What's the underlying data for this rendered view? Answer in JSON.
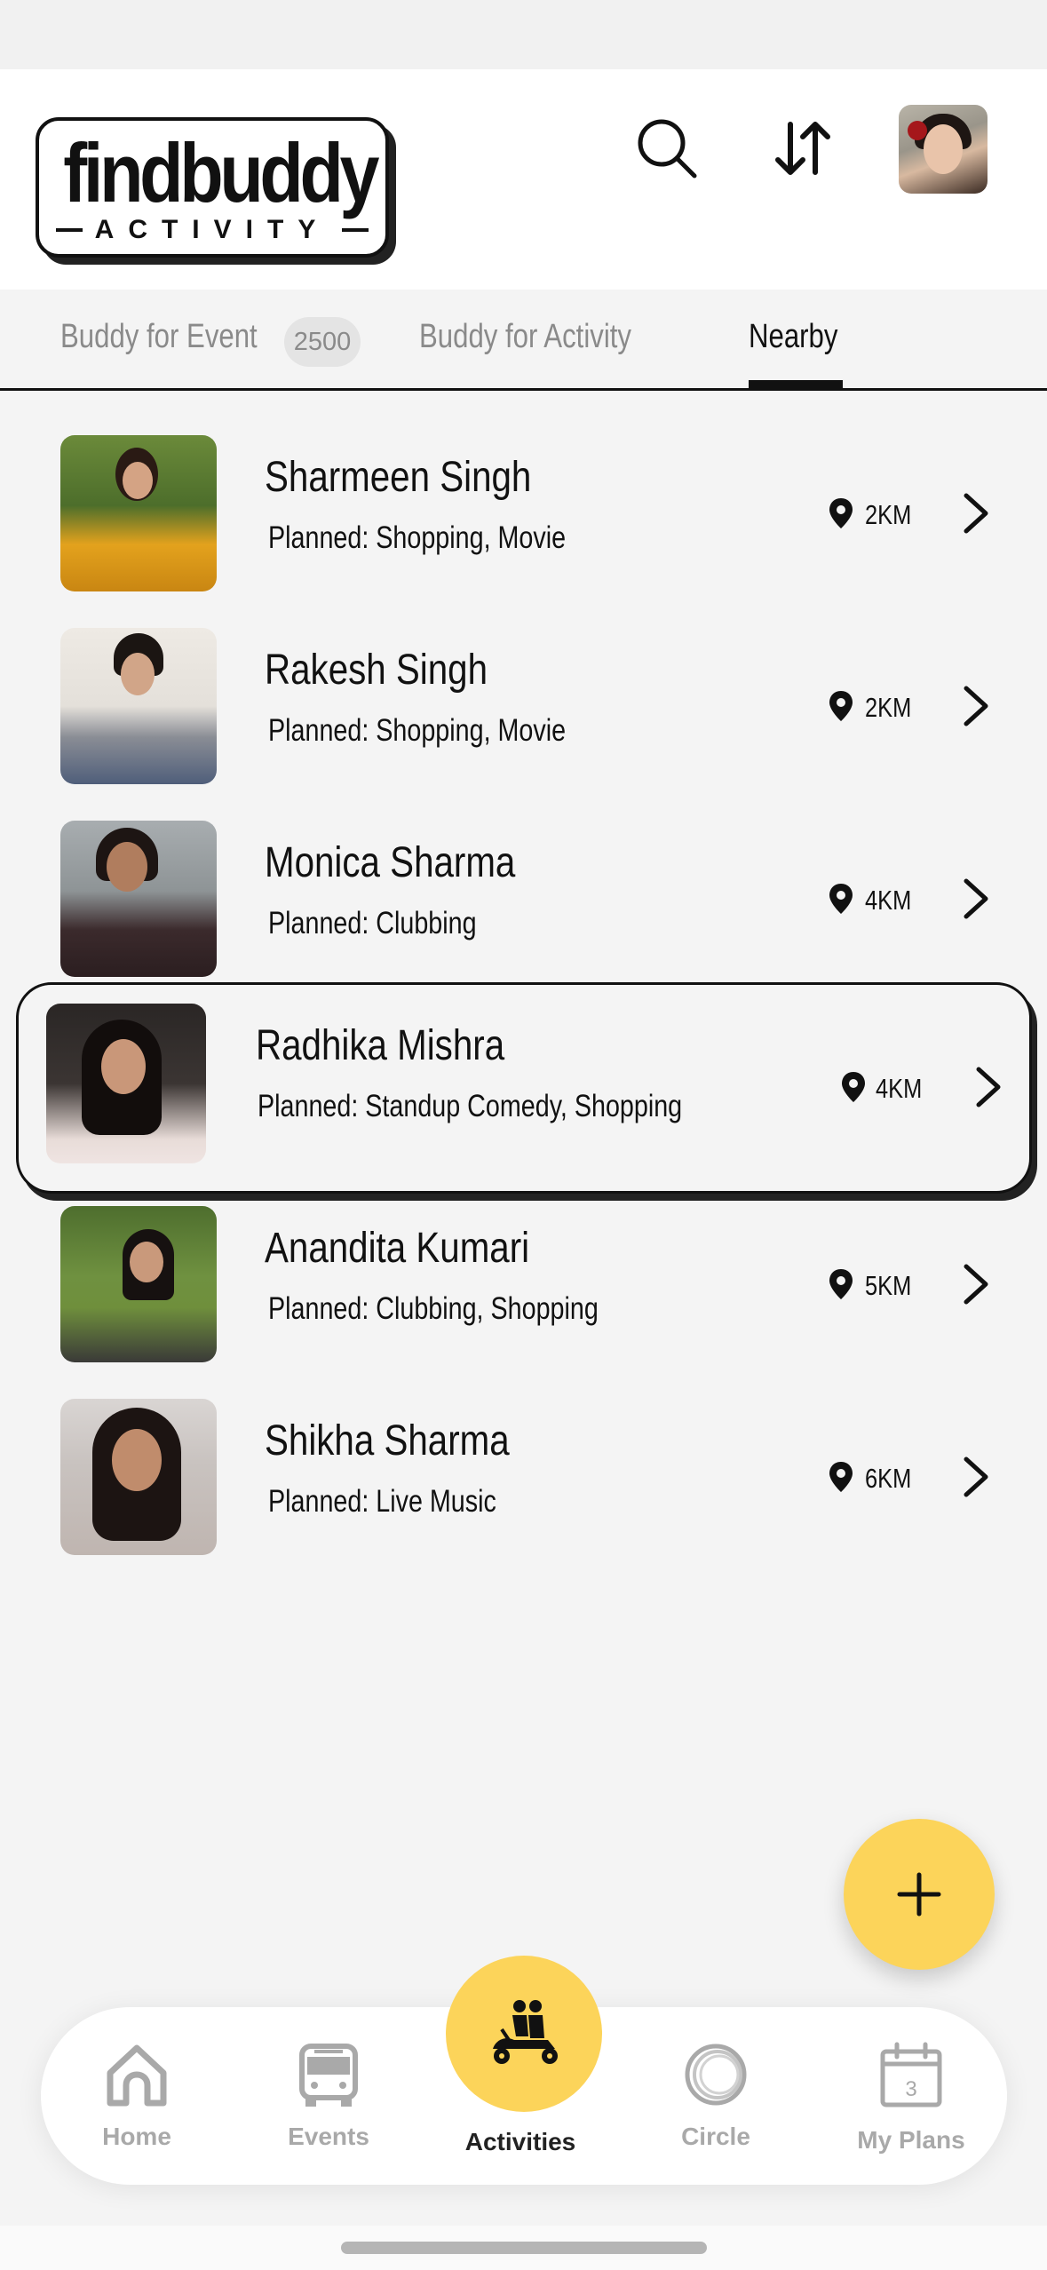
{
  "app": {
    "logo_main": "findbuddy",
    "logo_sub": "ACTIVITY"
  },
  "header": {
    "search_icon": "search-icon",
    "sort_icon": "sort-arrows-icon",
    "avatar": "user-avatar"
  },
  "tabs": [
    {
      "label": "Buddy for Event",
      "badge": "2500",
      "active": false
    },
    {
      "label": "Buddy for Activity",
      "active": false
    },
    {
      "label": "Nearby",
      "active": true
    }
  ],
  "buddies": [
    {
      "name": "Sharmeen Singh",
      "planned": "Planned: Shopping, Movie",
      "distance": "2KM"
    },
    {
      "name": "Rakesh Singh",
      "planned": "Planned: Shopping, Movie",
      "distance": "2KM"
    },
    {
      "name": "Monica Sharma",
      "planned": "Planned: Clubbing",
      "distance": "4KM"
    },
    {
      "name": "Radhika Mishra",
      "planned": "Planned: Standup Comedy, Shopping",
      "distance": "4KM",
      "highlighted": true
    },
    {
      "name": "Anandita Kumari",
      "planned": "Planned: Clubbing, Shopping",
      "distance": "5KM"
    },
    {
      "name": "Shikha Sharma",
      "planned": "Planned: Live Music",
      "distance": "6KM"
    }
  ],
  "fab": {
    "icon": "plus-icon"
  },
  "nav": [
    {
      "label": "Home",
      "icon": "home-icon"
    },
    {
      "label": "Events",
      "icon": "bus-icon"
    },
    {
      "label": "Activities",
      "icon": "scooter-riders-icon",
      "active": true
    },
    {
      "label": "Circle",
      "icon": "circle-icon"
    },
    {
      "label": "My Plans",
      "icon": "calendar-icon",
      "calendar_day": "3"
    }
  ],
  "colors": {
    "accent": "#fcd45a",
    "text": "#111111",
    "muted": "#8a8a8a",
    "background": "#f4f4f4"
  }
}
